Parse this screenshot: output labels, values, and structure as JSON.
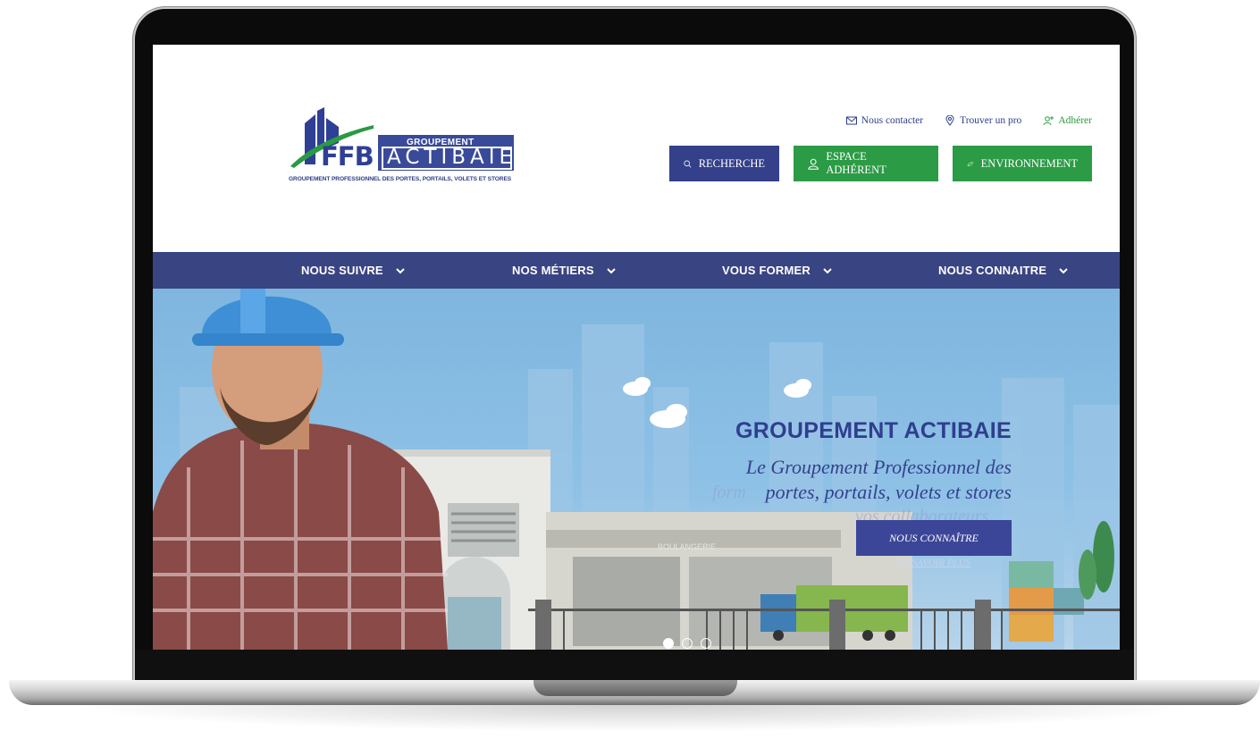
{
  "logo": {
    "ffb": "FFB",
    "groupement": "GROUPEMENT",
    "actibaie": "ACTIBAIE",
    "tagline": "GROUPEMENT PROFESSIONNEL DES PORTES, PORTAILS, VOLETS ET STORES"
  },
  "top_links": {
    "contact": "Nous contacter",
    "find_pro": "Trouver un pro",
    "join": "Adhérer"
  },
  "buttons": {
    "search": "RECHERCHE",
    "member_area": "ESPACE ADHÉRENT",
    "environment": "ENVIRONNEMENT"
  },
  "nav": {
    "items": [
      {
        "label": "NOUS SUIVRE"
      },
      {
        "label": "NOS MÉTIERS"
      },
      {
        "label": "VOUS FORMER"
      },
      {
        "label": "NOUS CONNAITRE"
      }
    ]
  },
  "hero": {
    "title": "GROUPEMENT ACTIBAIE",
    "subtitle_line1": "Le Groupement Professionnel des",
    "subtitle_line2": "portes, portails, volets et stores",
    "cta": "NOUS CONNAÎTRE",
    "ghost_cta": "EN SAVOIR PLUS",
    "ghost_text_1": "form",
    "ghost_text_2": "vos collaborateurs",
    "shop_sign": "BOULANGERIE",
    "slides_total": 3,
    "slide_active": 1
  },
  "colors": {
    "brand_blue": "#394483",
    "brand_green": "#2c9b45",
    "sky": "#8ec1e6"
  }
}
